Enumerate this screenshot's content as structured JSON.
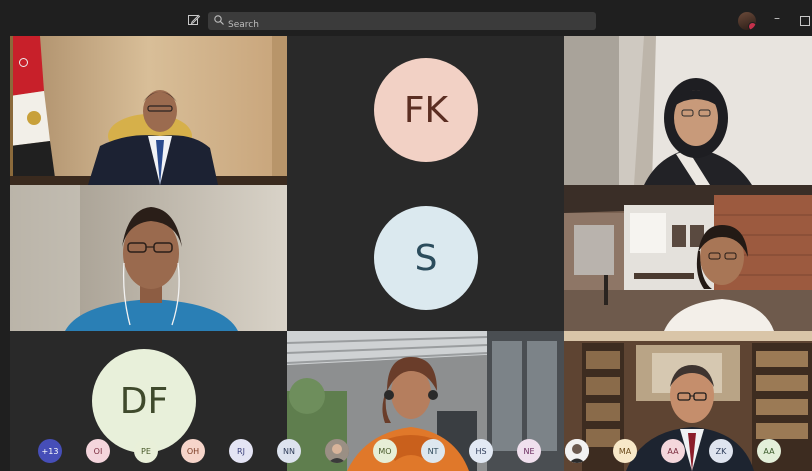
{
  "header": {
    "search_placeholder": "Search"
  },
  "tiles": [
    {
      "id": "t1",
      "kind": "video"
    },
    {
      "id": "t2",
      "kind": "initials",
      "initials": "FK"
    },
    {
      "id": "t3",
      "kind": "video"
    },
    {
      "id": "t4",
      "kind": "video"
    },
    {
      "id": "t5",
      "kind": "initials",
      "initials": "S"
    },
    {
      "id": "t6",
      "kind": "video"
    },
    {
      "id": "t7",
      "kind": "initials",
      "initials": "DF"
    },
    {
      "id": "t8",
      "kind": "video"
    },
    {
      "id": "t9",
      "kind": "video"
    }
  ],
  "roster": {
    "overflow_count": "+13",
    "chips": [
      "OI",
      "PE",
      "OH",
      "RJ",
      "NN",
      "MO",
      "NT",
      "HS",
      "NE",
      "MA",
      "AA",
      "ZK",
      "AA"
    ]
  },
  "colors": {
    "app_bg": "#1f1f1f",
    "tile_bg": "#292929",
    "overflow_chip": "#464eb8"
  }
}
